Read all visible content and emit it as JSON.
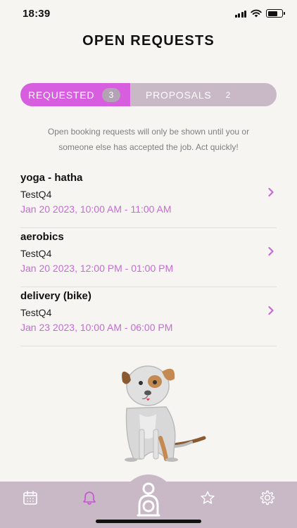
{
  "status_bar": {
    "time": "18:39",
    "icons": [
      "cellular-signal-icon",
      "wifi-icon",
      "battery-icon"
    ]
  },
  "page": {
    "title": "OPEN REQUESTS"
  },
  "segments": {
    "requested": {
      "label": "REQUESTED",
      "count": "3"
    },
    "proposals": {
      "label": "PROPOSALS",
      "count": "2"
    },
    "active": "requested"
  },
  "info": {
    "line1": "Open booking requests will only be shown until you or",
    "line2": "someone else has accepted the job. Act quickly!"
  },
  "requests": [
    {
      "activity": "yoga - hatha",
      "client": "TestQ4",
      "time": "Jan 20 2023, 10:00 AM - 11:00 AM"
    },
    {
      "activity": "aerobics",
      "client": "TestQ4",
      "time": "Jan 20 2023, 12:00 PM - 01:00 PM"
    },
    {
      "activity": "delivery (bike)",
      "client": "TestQ4",
      "time": "Jan 23 2023, 10:00 AM - 06:00 PM"
    }
  ],
  "tab_bar": {
    "tabs": [
      "calendar-icon",
      "bell-icon",
      "profile-icon",
      "star-icon",
      "gear-icon"
    ],
    "active": "bell-icon"
  },
  "colors": {
    "accent": "#d85ee0",
    "accent_text": "#c66bd6",
    "segment_bg": "#c9b8c6",
    "tab_bar_bg": "#c9b8c6",
    "background": "#f7f5f2"
  }
}
